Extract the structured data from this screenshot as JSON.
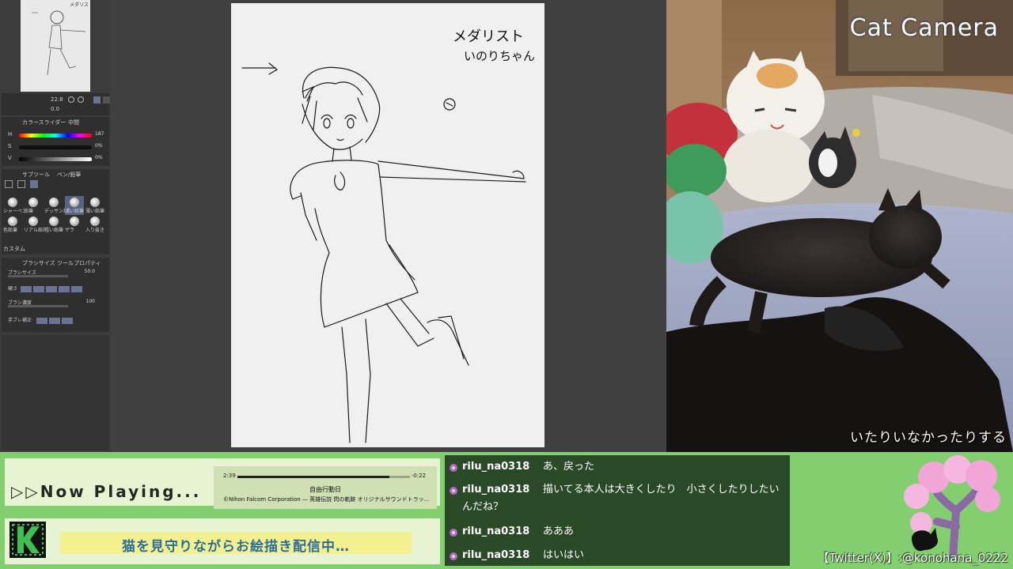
{
  "app": {
    "navigator": {
      "icon": "navigator-thumbnail"
    },
    "color_slider": {
      "tab_labels": [
        "カラースライダー",
        "中間"
      ],
      "channels": [
        {
          "key": "H",
          "value": "187"
        },
        {
          "key": "S",
          "value": "0%"
        },
        {
          "key": "V",
          "value": "0%"
        }
      ]
    },
    "subtool": {
      "tab_labels": [
        "サブツール",
        "ペン/鉛筆"
      ],
      "brushes": [
        "シャーペン",
        "鉛筆",
        "デッサン鉛筆",
        "濃い鉛筆",
        "薄い鉛筆",
        "色鉛筆",
        "リアル鉛筆",
        "粗い鉛筆",
        "ザラ",
        "入り抜き"
      ],
      "custom_label": "カスタム"
    },
    "tool_property": {
      "tab_labels": [
        "ブラシサイズ",
        "ツールプロパティ"
      ],
      "brush_size_label": "ブラシサイズ",
      "brush_size_value": "50.0",
      "hardness_label": "硬さ",
      "density_label": "ブラシ濃度",
      "density_value": "100",
      "stabilize_label": "手ブレ補正"
    },
    "toolbar_values": [
      "22.8",
      "0.0"
    ]
  },
  "canvas": {
    "note_title": "メダリスト",
    "note_sub": "いのりちゃん"
  },
  "cat_camera": {
    "title": "Cat Camera",
    "caption": "いたりいなかったりする"
  },
  "now_playing": {
    "label": "▷▷Now Playing...",
    "elapsed": "2:39",
    "remaining": "-0:22",
    "progress": 0.88,
    "song": "自由行動日",
    "credit": "©Nihon Falcom Corporation — 英雄伝説 閃の軌跡 オリジナルサウンドトラッ..."
  },
  "stream_message": "猫を見守りながらお絵描き配信中…",
  "chat": [
    {
      "user": "rilu_na0318",
      "text": "あ、戻った"
    },
    {
      "user": "rilu_na0318",
      "text": "描いてる本人は大きくしたり　小さくしたりしたいんだね？"
    },
    {
      "user": "rilu_na0318",
      "text": "あああ"
    },
    {
      "user": "rilu_na0318",
      "text": "はいはい"
    }
  ],
  "twitter": "【Twitter(X)】:@konohana_0222",
  "colors": {
    "bottom_bar": "#83cf6f",
    "chat_bg": "#1e371e",
    "accent_blue": "#2c6d9c",
    "strip_yellow": "#f3f18f"
  }
}
